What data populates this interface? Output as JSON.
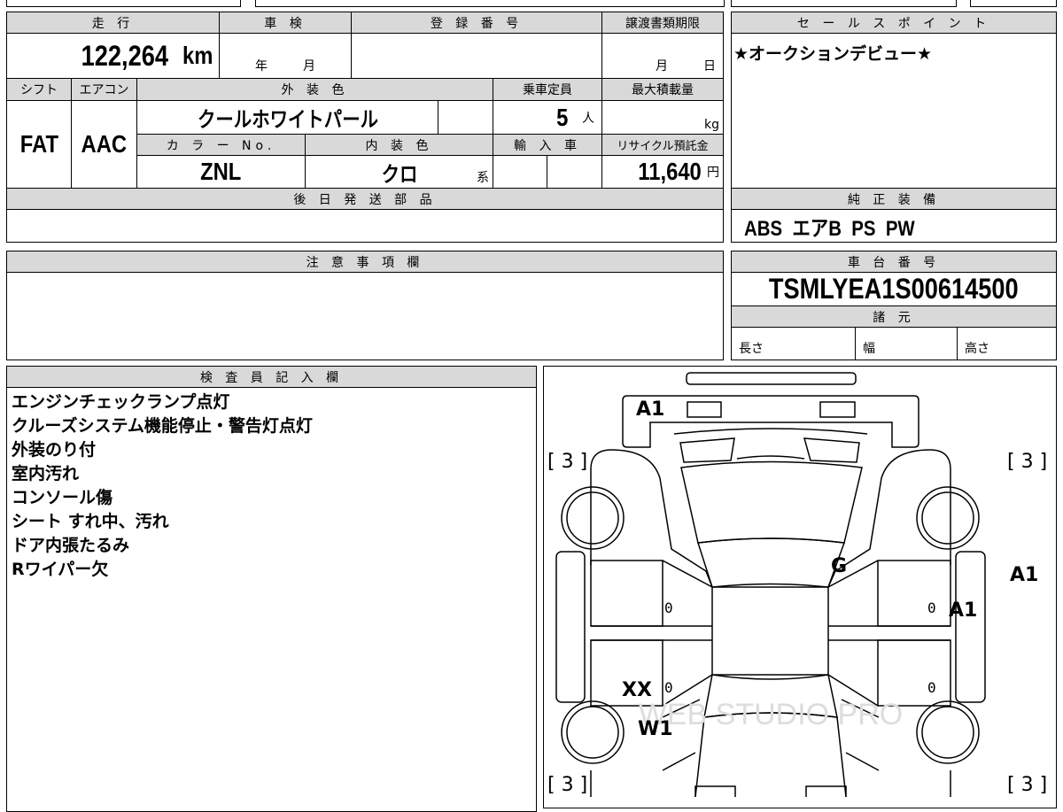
{
  "table": {
    "mileage_header": "走 行",
    "mileage": "122,264",
    "mileage_unit": "km",
    "shaken_header": "車 検",
    "shaken_year": "年",
    "shaken_month": "月",
    "reg_header": "登 録 番 号",
    "transfer_header": "譲渡書類期限",
    "transfer_month": "月",
    "transfer_day": "日",
    "shift_header": "シフト",
    "shift": "FAT",
    "ac_header": "エアコン",
    "ac": "AAC",
    "ext_color_header": "外 装 色",
    "ext_color": "クールホワイトパール",
    "capacity_header": "乗車定員",
    "capacity": "5",
    "capacity_unit": "人",
    "max_load_header": "最大積載量",
    "max_load_unit": "kg",
    "color_no_header": "カ ラ ー No.",
    "color_no": "ZNL",
    "int_color_header": "内 装 色",
    "int_color": "クロ",
    "int_color_suffix": "系",
    "import_header": "輸 入 車",
    "recycle_header": "リサイクル預託金",
    "recycle": "11,640",
    "recycle_unit": "円",
    "later_parts_header": "後 日 発 送 部 品"
  },
  "sales_point": {
    "header": "セ ー ル ス ポ イ ン ト",
    "text": "★オークションデビュー★"
  },
  "equipment": {
    "header": "純 正 装 備",
    "text": "ABS  エアB  PS  PW"
  },
  "notice": {
    "header": "注 意 事 項 欄"
  },
  "chassis": {
    "header": "車 台 番 号",
    "number": "TSMLYEA1S00614500",
    "spec_header": "諸 元",
    "length": "長さ",
    "width": "幅",
    "height": "高さ"
  },
  "inspector": {
    "header": "検 査 員 記 入 欄",
    "notes": [
      "エンジンチェックランプ点灯",
      "クルーズシステム機能停止・警告灯点灯",
      "外装のり付",
      "室内汚れ",
      "コンソール傷",
      "シート すれ中、汚れ",
      "ドア内張たるみ",
      "Rワイパー欠"
    ]
  },
  "diagram": {
    "marks": {
      "rear": "A1",
      "tl": "[ 3 ]",
      "tr": "[ 3 ]",
      "bl": "[ 3 ]",
      "br": "[ 3 ]",
      "windshield": "G",
      "right_mirror": "A1",
      "right_door": "A1",
      "left_rear": "XX",
      "left_glass": "W1",
      "zero": "0"
    },
    "watermark": "WEB STUDIO PRO"
  }
}
